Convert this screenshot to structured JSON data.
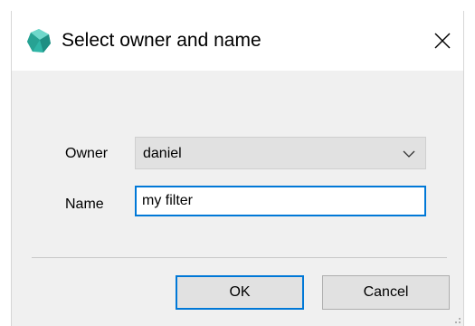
{
  "dialog": {
    "title": "Select owner and name",
    "app_icon": "teal-gem-icon",
    "close_icon": "close-icon"
  },
  "form": {
    "owner_label": "Owner",
    "owner_value": "daniel",
    "owner_dropdown_icon": "chevron-down-icon",
    "name_label": "Name",
    "name_value": "my filter"
  },
  "buttons": {
    "ok_label": "OK",
    "cancel_label": "Cancel"
  },
  "colors": {
    "accent": "#0078d7",
    "dialog_bg": "#f0f0f0",
    "titlebar_bg": "#ffffff",
    "icon_teal": "#2fb5a6"
  }
}
